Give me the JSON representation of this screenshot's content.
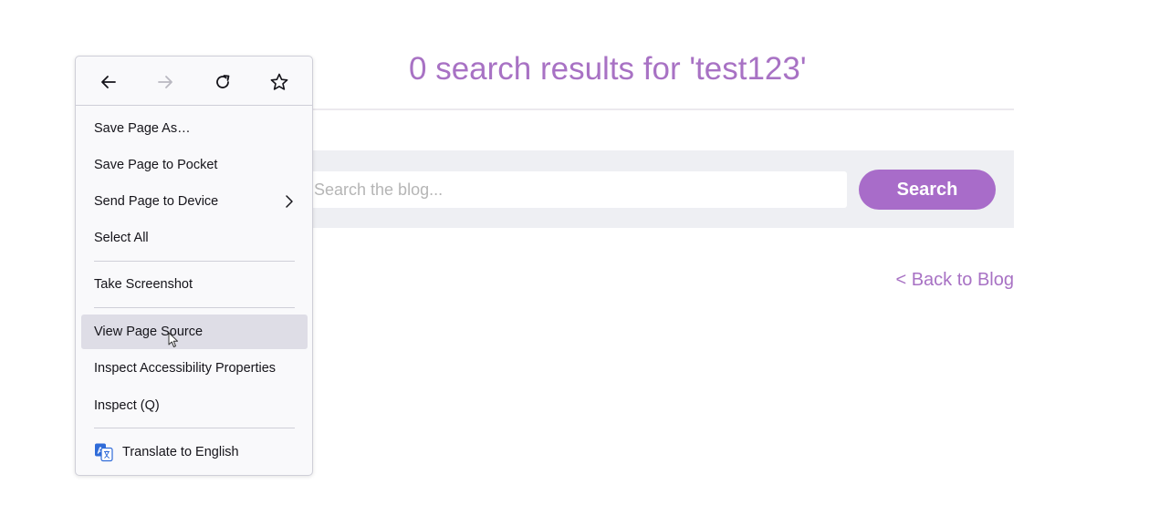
{
  "page": {
    "heading": "0 search results for 'test123'",
    "search": {
      "placeholder": "Search the blog...",
      "button_label": "Search"
    },
    "back_link": "< Back to Blog",
    "accent_color": "#a872c4"
  },
  "context_menu": {
    "nav_icons": [
      "back-arrow-icon",
      "forward-arrow-icon",
      "reload-icon",
      "bookmark-star-icon"
    ],
    "items": [
      {
        "label": "Save Page As…"
      },
      {
        "label": "Save Page to Pocket"
      },
      {
        "label": "Send Page to Device",
        "submenu": true
      },
      {
        "label": "Select All"
      },
      {
        "label": "Take Screenshot"
      },
      {
        "label": "View Page Source",
        "highlighted": true
      },
      {
        "label": "Inspect Accessibility Properties"
      },
      {
        "label": "Inspect (Q)"
      },
      {
        "label": "Translate to English",
        "icon": "translate-icon"
      }
    ]
  }
}
